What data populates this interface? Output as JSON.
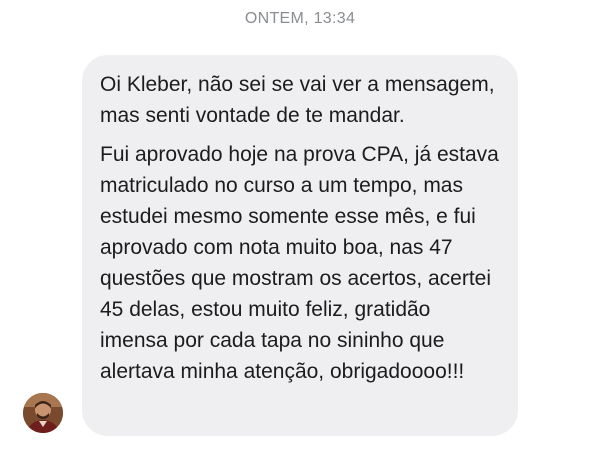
{
  "thread": {
    "timestamp": "ONTEM, 13:34"
  },
  "message": {
    "paragraphs": [
      "Oi Kleber, não sei se vai ver a mensagem, mas senti vontade de te mandar.",
      "Fui aprovado hoje na prova CPA, já estava matriculado no curso a um tempo, mas estudei mesmo somente esse mês, e fui aprovado com nota muito boa, nas 47 questões que mostram os acertos, acertei 45 delas, estou muito feliz, gratidão imensa por cada tapa no sininho que alertava minha atenção, obrigadoooo!!!"
    ]
  },
  "sender": {
    "avatar_icon": "profile-photo"
  },
  "colors": {
    "bubble_background": "#efeff2",
    "text": "#1c1c1e",
    "timestamp": "#8a8d91"
  }
}
